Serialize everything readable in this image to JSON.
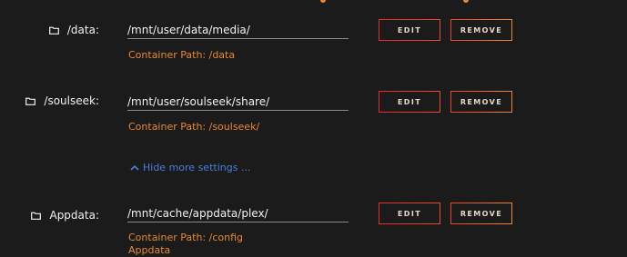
{
  "mappings": [
    {
      "label": "/data:",
      "host_path": "/mnt/user/data/media/",
      "container_path": "Container Path: /data",
      "description": ""
    },
    {
      "label": "/soulseek:",
      "host_path": "/mnt/user/soulseek/share/",
      "container_path": "Container Path: /soulseek/",
      "description": ""
    },
    {
      "label": "Appdata:",
      "host_path": "/mnt/cache/appdata/plex/",
      "container_path": "Container Path: /config",
      "description": "Appdata"
    }
  ],
  "buttons": {
    "edit_label": "EDIT",
    "remove_label": "REMOVE"
  },
  "toggle": {
    "hide_more_label": "Hide more settings ..."
  },
  "icons": {
    "folder": "folder-icon",
    "chevron": "chevron-up-icon"
  },
  "colors": {
    "background": "#1c1b1b",
    "accent_orange": "#e6892f",
    "button_red": "#e8442c",
    "link_blue": "#4a7ed6",
    "text": "#f2f2f2"
  }
}
